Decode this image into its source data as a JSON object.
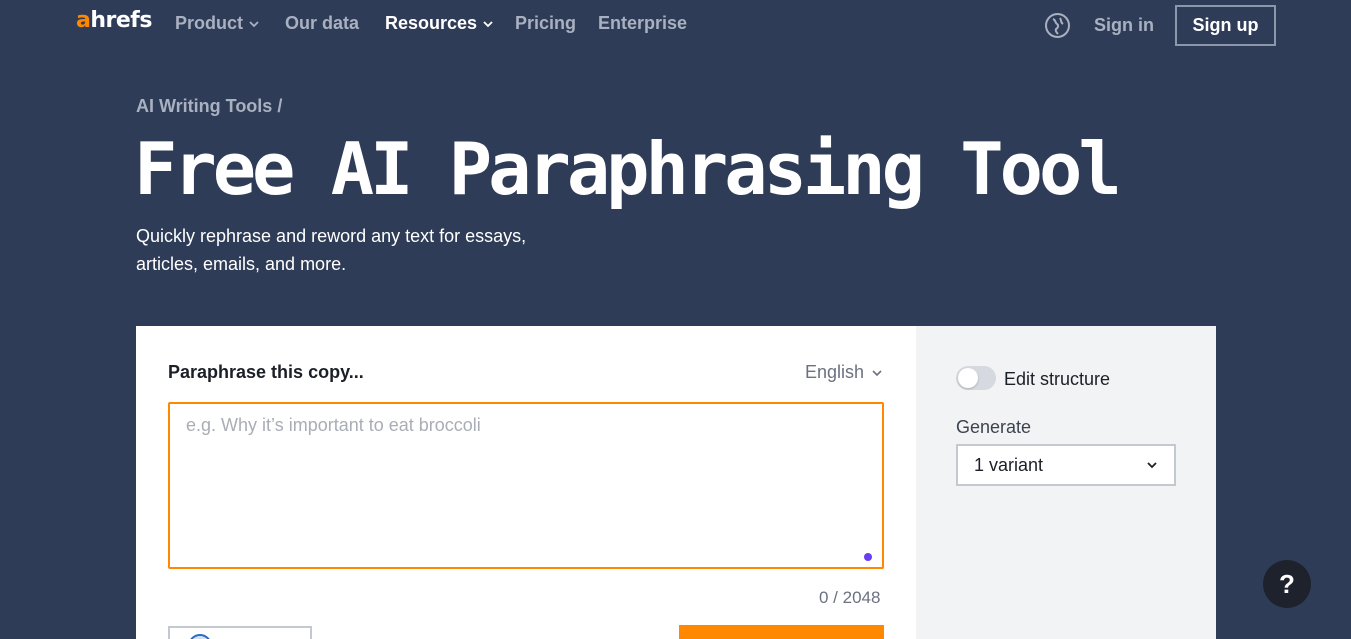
{
  "nav": {
    "logo_accent": "a",
    "logo_rest": "hrefs",
    "items": [
      {
        "label": "Product",
        "has_dropdown": true
      },
      {
        "label": "Our data",
        "has_dropdown": false
      },
      {
        "label": "Resources",
        "has_dropdown": true
      },
      {
        "label": "Pricing",
        "has_dropdown": false
      },
      {
        "label": "Enterprise",
        "has_dropdown": false
      }
    ],
    "language_icon": "globe-icon",
    "signin_label": "Sign in",
    "signup_label": "Sign up"
  },
  "hero": {
    "breadcrumb": "AI Writing Tools /",
    "title": "Free AI Paraphrasing Tool",
    "subtitle": "Quickly rephrase and reword any text for essays, articles, emails, and more."
  },
  "tool": {
    "heading": "Paraphrase this copy...",
    "language": "English",
    "input": {
      "value": "",
      "placeholder": "e.g. Why it’s important to eat broccoli"
    },
    "counter": "0 / 2048",
    "options": {
      "edit_structure_label": "Edit structure",
      "edit_structure_on": false,
      "generate_label": "Generate",
      "generate_value": "1 variant"
    }
  },
  "help_label": "?",
  "colors": {
    "background": "#2f3c57",
    "accent": "#ff8800",
    "muted_text": "#a9b1c1"
  }
}
